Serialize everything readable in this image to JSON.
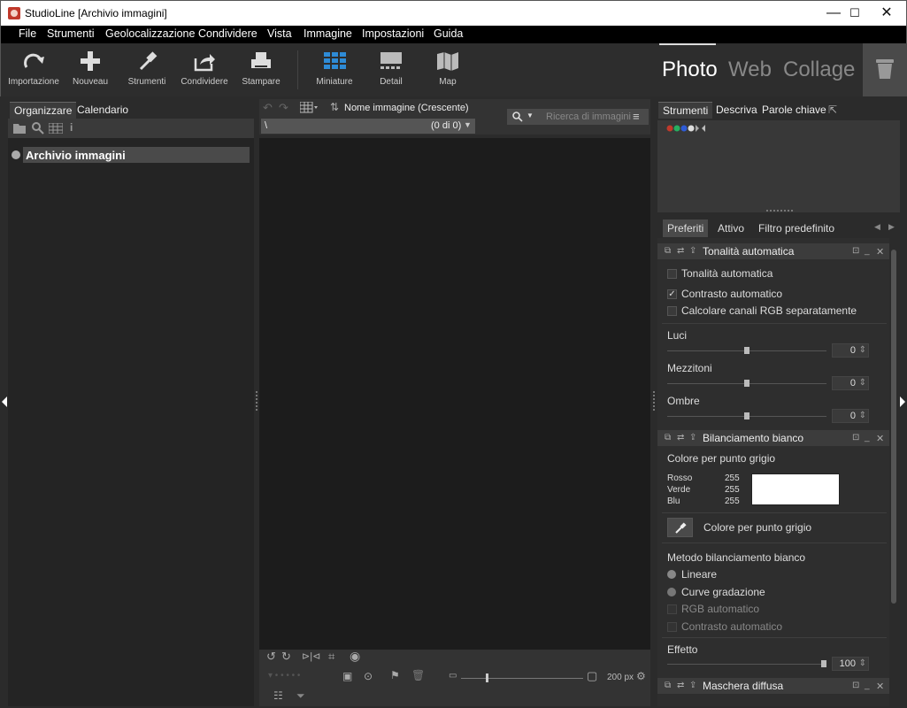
{
  "window": {
    "title": "StudioLine [Archivio immagini]",
    "minimize": "—",
    "maximize": "☐",
    "close": "✕"
  },
  "menu": [
    "File",
    "Strumenti",
    "Geolocalizzazione",
    "Condividere",
    "Vista",
    "Immagine",
    "Impostazioni",
    "Guida"
  ],
  "toolbar": {
    "importazione": "Importazione",
    "nouveau": "Nouveau",
    "strumenti": "Strumenti",
    "condividere": "Condividere",
    "stampare": "Stampare",
    "miniature": "Miniature",
    "detail": "Detail",
    "map": "Map"
  },
  "modes": {
    "photo": "Photo",
    "web": "Web",
    "collage": "Collage"
  },
  "left": {
    "tabs": [
      "Organizzare",
      "Calendario"
    ],
    "tree_item": "Archivio immagini"
  },
  "center": {
    "sort_label": "Nome immagine (Crescente)",
    "path": "\\",
    "count": "(0 di 0)",
    "search_placeholder": "Ricerca di immagini",
    "zoom_value": "200 px"
  },
  "right": {
    "tabs": [
      "Strumenti",
      "Descriva",
      "Parole chiave"
    ],
    "subtabs": [
      "Preferiti",
      "Attivo",
      "Filtro predefinito"
    ],
    "tonalita": {
      "title": "Tonalità automatica",
      "opt1": "Tonalità automatica",
      "opt2": "Contrasto automatico",
      "opt3": "Calcolare canali RGB separatamente",
      "luci": "Luci",
      "luci_val": "0",
      "mezzitoni": "Mezzitoni",
      "mezzitoni_val": "0",
      "ombre": "Ombre",
      "ombre_val": "0"
    },
    "bilanciamento": {
      "title": "Bilanciamento bianco",
      "color_label": "Colore per punto grigio",
      "rosso": "Rosso",
      "rosso_val": "255",
      "verde": "Verde",
      "verde_val": "255",
      "blu": "Blu",
      "blu_val": "255",
      "picker_label": "Colore per punto grigio",
      "metodo": "Metodo bilanciamento bianco",
      "lineare": "Lineare",
      "curve": "Curve gradazione",
      "rgb_auto": "RGB automatico",
      "contrasto_auto": "Contrasto automatico",
      "effetto": "Effetto",
      "effetto_val": "100"
    },
    "maschera": {
      "title": "Maschera diffusa"
    }
  },
  "colors": {
    "accent": "#2e8bd6",
    "background": "#2b2b2b",
    "viewport": "#1c1c1c"
  }
}
